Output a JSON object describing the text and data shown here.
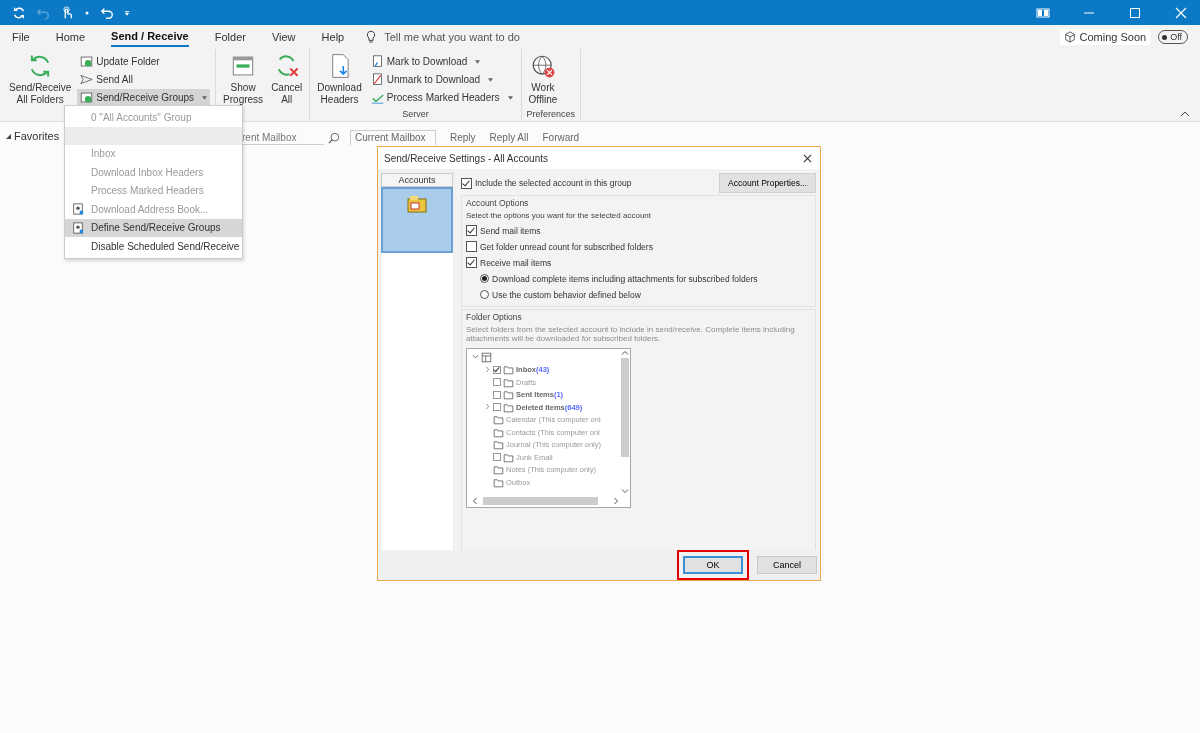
{
  "tabs": [
    {
      "label": "File",
      "selected": false
    },
    {
      "label": "Home",
      "selected": false
    },
    {
      "label": "Send / Receive",
      "selected": true
    },
    {
      "label": "Folder",
      "selected": false
    },
    {
      "label": "View",
      "selected": false
    },
    {
      "label": "Help",
      "selected": false
    }
  ],
  "tell_me": {
    "placeholder": "Tell me what you want to do"
  },
  "coming_soon": {
    "label": "Coming Soon",
    "toggle": "Off",
    "on": false
  },
  "ribbon": [
    {
      "items": [
        {
          "kind": "large",
          "label": "Send/Receive\nAll Folders"
        },
        {
          "kind": "small",
          "label": "Update Folder",
          "menu": false,
          "expanded": false
        },
        {
          "kind": "small",
          "label": "Send All",
          "menu": false,
          "expanded": false
        },
        {
          "kind": "small",
          "label": "Send/Receive Groups",
          "menu": true,
          "expanded": true
        }
      ]
    },
    {
      "items": [
        {
          "kind": "large",
          "label": "Show\nProgress"
        },
        {
          "kind": "large",
          "label": "Cancel\nAll"
        }
      ]
    },
    {
      "label": "Server",
      "items": [
        {
          "kind": "large",
          "label": "Download\nHeaders"
        },
        {
          "kind": "small",
          "label": "Mark to Download",
          "menu": true,
          "expanded": false
        },
        {
          "kind": "small",
          "label": "Unmark to Download",
          "menu": true,
          "expanded": false
        },
        {
          "kind": "small",
          "label": "Process Marked Headers",
          "menu": true,
          "expanded": false
        }
      ]
    },
    {
      "label": "Preferences",
      "items": [
        {
          "kind": "large",
          "label": "Work\nOffline"
        }
      ]
    }
  ],
  "menu": [
    {
      "kind": "item",
      "label": "0 \"All Accounts\" Group",
      "disabled": true,
      "selected": false
    },
    {
      "kind": "blank"
    },
    {
      "kind": "item",
      "label": "Inbox",
      "disabled": true,
      "selected": false
    },
    {
      "kind": "item",
      "label": "Download Inbox Headers",
      "disabled": true,
      "selected": false
    },
    {
      "kind": "item",
      "label": "Process Marked Headers",
      "disabled": true,
      "selected": false
    },
    {
      "kind": "item",
      "label": "Download Address Book...",
      "disabled": true,
      "selected": false,
      "icon": true
    },
    {
      "kind": "item",
      "label": "Define Send/Receive Groups",
      "disabled": false,
      "selected": true,
      "icon": true
    },
    {
      "kind": "item",
      "label": "Disable Scheduled Send/Receive",
      "disabled": false,
      "selected": false
    }
  ],
  "navigation": {
    "favorites": "Favorites",
    "search": {
      "placeholder": "rent Mailbox"
    },
    "scope": "Current Mailbox",
    "actions": [
      "Reply",
      "Reply All",
      "Forward"
    ]
  },
  "dialog": {
    "title": "Send/Receive Settings - All Accounts",
    "accounts_header": "Accounts",
    "accounts": [
      {
        "selected": true
      }
    ],
    "include": {
      "label": "Include the selected account in this group",
      "checked": true
    },
    "properties_button": "Account Properties...",
    "account_options": {
      "title": "Account Options",
      "description": "Select the options you want for the selected account",
      "checkboxes": [
        {
          "label": "Send mail items",
          "checked": true
        },
        {
          "label": "Get folder unread count for subscribed folders",
          "checked": false
        },
        {
          "label": "Receive mail items",
          "checked": true
        }
      ],
      "radios": [
        {
          "label": "Download complete items including attachments for subscribed folders",
          "selected": true
        },
        {
          "label": "Use the custom behavior defined below",
          "selected": false
        }
      ]
    },
    "folder_options": {
      "title": "Folder Options",
      "description": "Select folders from the selected account to include in send/receive. Complete items including attachments will be downloaded for subscribed folders.",
      "tree": [
        {
          "expanded": true,
          "children": [
            {
              "kind": "checkable",
              "name": "Inbox",
              "count": "(43)",
              "bold": true,
              "checked": true,
              "expanded": false
            },
            {
              "kind": "checkable",
              "name": "Drafts",
              "bold": false,
              "checked": false
            },
            {
              "kind": "checkable",
              "name": "Sent Items",
              "count": "(1)",
              "bold": true,
              "checked": false
            },
            {
              "kind": "checkable",
              "name": "Deleted Items",
              "count": "(649)",
              "bold": true,
              "checked": false,
              "expanded": false
            },
            {
              "kind": "plain",
              "name": "Calendar (This computer onl",
              "bold": false
            },
            {
              "kind": "plain",
              "name": "Contacts (This computer onl",
              "bold": false
            },
            {
              "kind": "plain",
              "name": "Journal (This computer only)",
              "bold": false
            },
            {
              "kind": "checkable",
              "name": "Junk Email",
              "bold": false,
              "checked": false
            },
            {
              "kind": "plain",
              "name": "Notes (This computer only)",
              "bold": false
            },
            {
              "kind": "plain",
              "name": "Outbox",
              "bold": false
            }
          ]
        }
      ]
    },
    "buttons": [
      {
        "label": "OK",
        "default": true,
        "highlighted": true
      },
      {
        "label": "Cancel",
        "default": false,
        "highlighted": false
      }
    ]
  }
}
